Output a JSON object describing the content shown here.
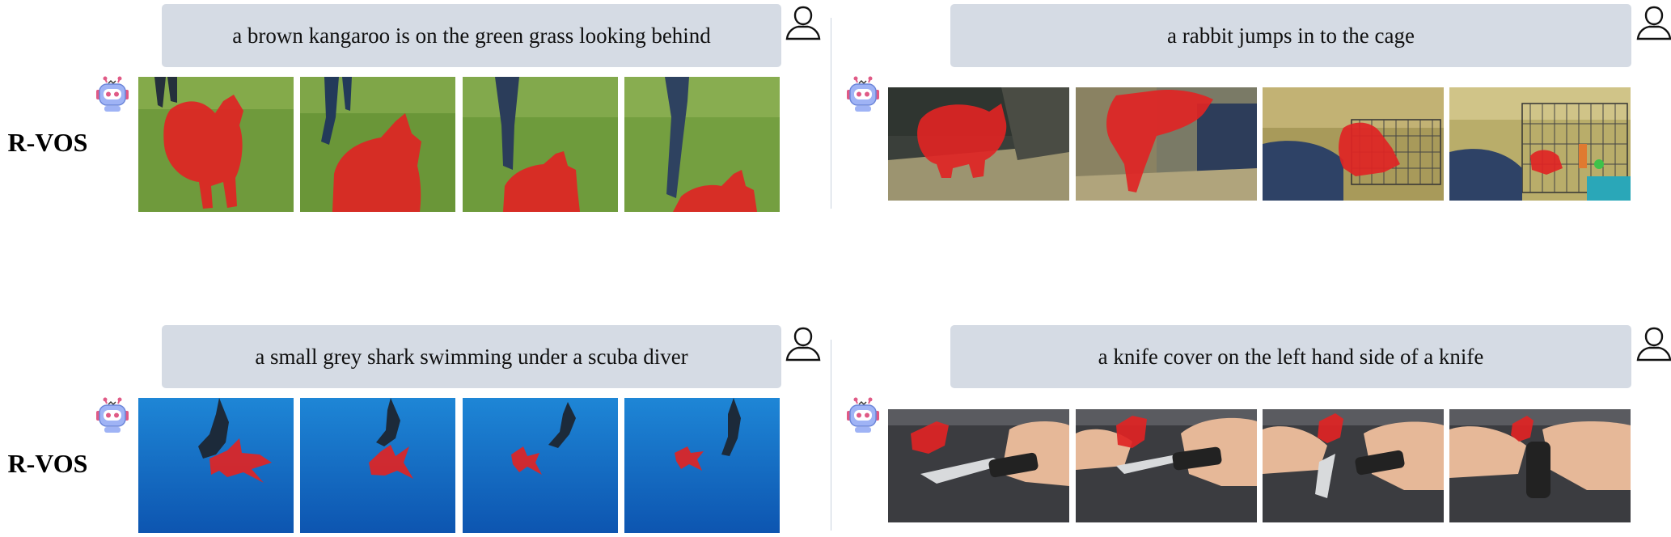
{
  "panels": [
    {
      "task": "R-VOS",
      "query": "a brown kangaroo is on the green grass looking behind"
    },
    {
      "task": "",
      "query": "a rabbit jumps in to the cage"
    },
    {
      "task": "R-VOS",
      "query": "a small grey shark swimming under a scuba diver"
    },
    {
      "task": "",
      "query": "a knife cover on the left hand side of a knife"
    }
  ],
  "colors": {
    "bubble": "#d5dbe4",
    "mask": "#e02424",
    "divider": "#c9d3de"
  },
  "icons": {
    "user": "user-outline-icon",
    "assistant": "robot-icon"
  }
}
